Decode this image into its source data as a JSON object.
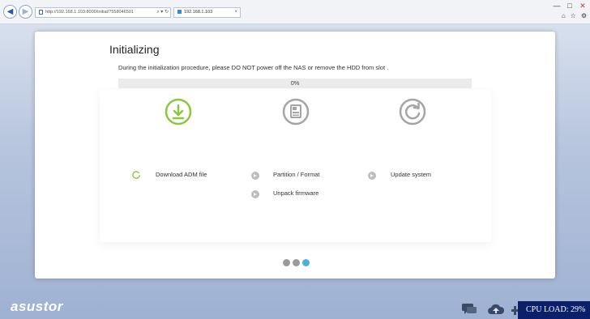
{
  "browser": {
    "address": "http://192.168.1.103:8000/initial/?558046501",
    "address_controls": "⌕ ▾ ↻",
    "tab_title": "192.168.1.103",
    "tab_close": "×",
    "window_controls": [
      "—",
      "□",
      "✕"
    ],
    "tool_icons": [
      "home-icon",
      "star-icon",
      "gear-icon"
    ]
  },
  "dialog": {
    "title": "Initializing",
    "subtitle": "During the initialization procedure, please DO NOT power off the NAS or remove the HDD from slot .",
    "progress_value": 0,
    "progress_text": "0%",
    "steps": [
      {
        "name": "download",
        "icon": "download-icon",
        "status": "active",
        "color": "#8cc63f"
      },
      {
        "name": "partition",
        "icon": "disk-icon",
        "status": "pending",
        "color": "#a5a5a5"
      },
      {
        "name": "update",
        "icon": "refresh-icon",
        "status": "pending",
        "color": "#a5a5a5"
      }
    ],
    "tasks": {
      "download_adm": "Download ADM file",
      "partition_format": "Partition / Format",
      "unpack_firmware": "Unpack firmware",
      "update_system": "Update system"
    },
    "pager": {
      "total": 3,
      "active": 3
    }
  },
  "taskbar": {
    "logo": "asustor",
    "cpu_load": "CPU LOAD: 29%",
    "icons": [
      "chat-icon",
      "cloud-upload-icon",
      "plus-icon"
    ]
  },
  "colors": {
    "accent": "#4db0d6",
    "download_green": "#8cc63f",
    "inactive_gray": "#a5a5a5",
    "cpu_bg": "#0b1f6b"
  }
}
